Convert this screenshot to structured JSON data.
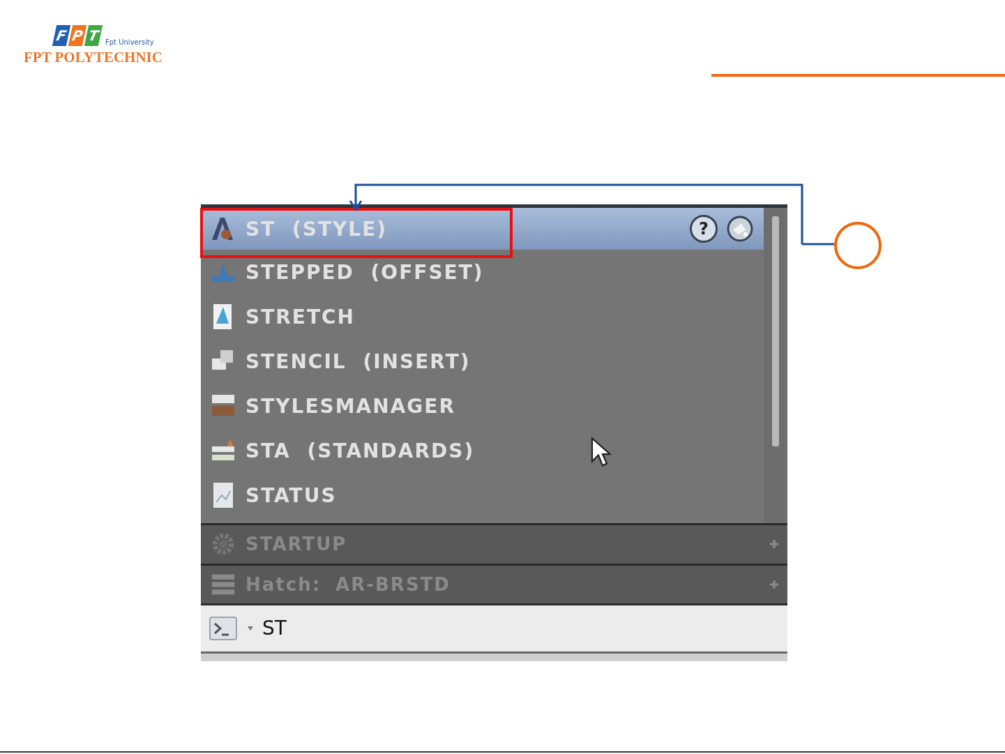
{
  "logo": {
    "letters": [
      {
        "text": "F",
        "color": "#1f5fb4"
      },
      {
        "text": "P",
        "color": "#f0731e"
      },
      {
        "text": "T",
        "color": "#3fa845"
      }
    ],
    "university": "Fpt University",
    "name": "FPT POLYTECHNIC"
  },
  "command_list": {
    "help_button": "?",
    "items": [
      {
        "label": "ST (STYLE)",
        "selected": true
      },
      {
        "label": "STEPPED (OFFSET)",
        "selected": false
      },
      {
        "label": "STRETCH",
        "selected": false
      },
      {
        "label": "STENCIL (INSERT)",
        "selected": false
      },
      {
        "label": "STYLESMANAGER",
        "selected": false
      },
      {
        "label": "STA (STANDARDS)",
        "selected": false
      },
      {
        "label": "STATUS",
        "selected": false
      }
    ]
  },
  "sections": [
    {
      "label": "STARTUP",
      "kind": "gear"
    },
    {
      "label": "Hatch: AR-BRSTD",
      "kind": "hatch"
    }
  ],
  "command_line": {
    "value": "ST"
  }
}
